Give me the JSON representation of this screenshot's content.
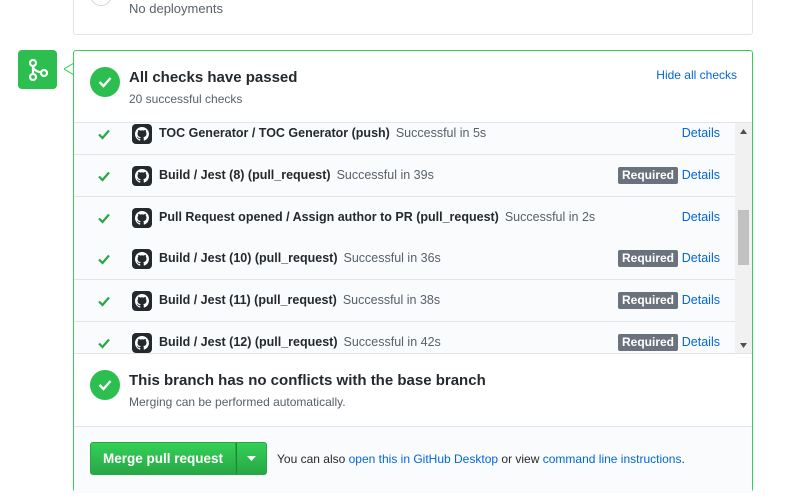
{
  "deployments": {
    "status_text": "No deployments"
  },
  "checks": {
    "title": "All checks have passed",
    "subtitle": "20 successful checks",
    "toggle_label": "Hide all checks",
    "details_label": "Details",
    "required_label": "Required",
    "rows": [
      {
        "name": "TOC Generator / TOC Generator (push)",
        "status": "Successful in 5s",
        "required": false
      },
      {
        "name": "Build / Jest (8) (pull_request)",
        "status": "Successful in 39s",
        "required": true
      },
      {
        "name": "Pull Request opened / Assign author to PR (pull_request)",
        "status": "Successful in 2s",
        "required": false
      },
      {
        "name": "Build / Jest (10) (pull_request)",
        "status": "Successful in 36s",
        "required": true
      },
      {
        "name": "Build / Jest (11) (pull_request)",
        "status": "Successful in 38s",
        "required": true
      },
      {
        "name": "Build / Jest (12) (pull_request)",
        "status": "Successful in 42s",
        "required": true
      }
    ]
  },
  "conflicts": {
    "title": "This branch has no conflicts with the base branch",
    "subtitle": "Merging can be performed automatically."
  },
  "merge": {
    "button_label": "Merge pull request",
    "note_prefix": "You can also",
    "desktop_link": "open this in GitHub Desktop",
    "note_middle": "or view",
    "cli_link": "command line instructions",
    "note_suffix": "."
  },
  "colors": {
    "success": "#2cbe4e",
    "link": "#0366d6",
    "badge": "#6a737d"
  },
  "icons": {
    "merge_badge": "git-merge-icon",
    "status": "check-icon",
    "row_check": "check-icon",
    "app_logo": "github-logo-icon",
    "dropdown": "triangle-down-icon"
  }
}
